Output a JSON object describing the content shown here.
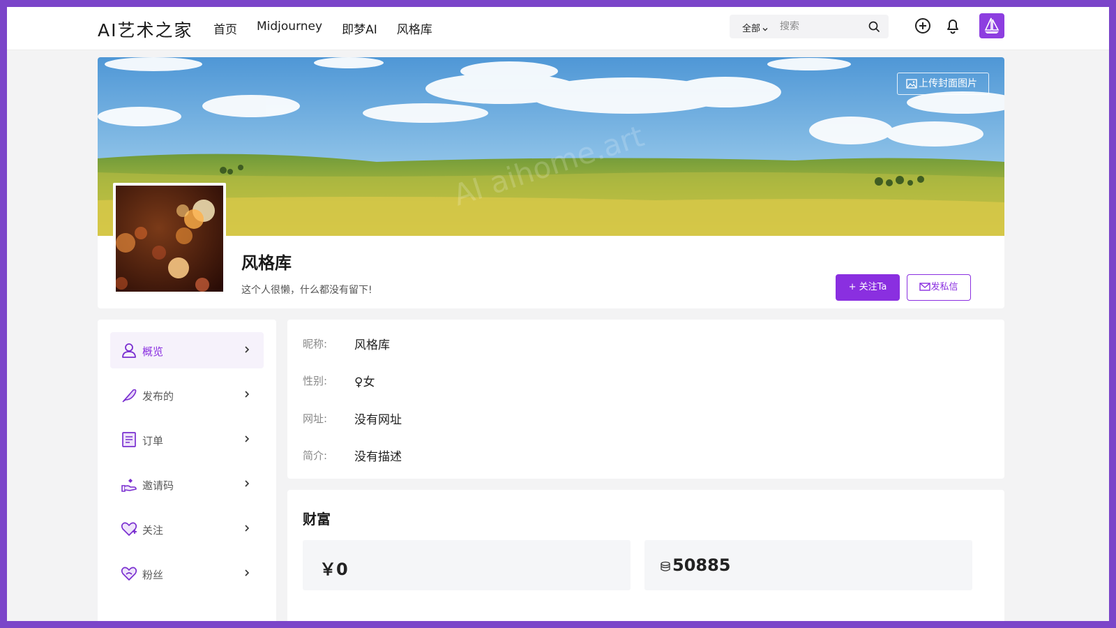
{
  "header": {
    "logo": "AI艺术之家",
    "nav": [
      "首页",
      "Midjourney",
      "即梦AI",
      "风格库"
    ],
    "search_scope": "全部",
    "search_placeholder": "搜索"
  },
  "banner": {
    "upload_label": "上传封面图片",
    "watermark": "AI aihome.art"
  },
  "profile": {
    "name": "风格库",
    "bio": "这个人很懒，什么都没有留下!",
    "follow_label": "+ 关注Ta",
    "message_label": "发私信"
  },
  "sidebar": {
    "items": [
      {
        "label": "概览",
        "icon": "user-icon",
        "active": true
      },
      {
        "label": "发布的",
        "icon": "feather-icon",
        "active": false
      },
      {
        "label": "订单",
        "icon": "order-icon",
        "active": false
      },
      {
        "label": "邀请码",
        "icon": "invite-icon",
        "active": false
      },
      {
        "label": "关注",
        "icon": "heart-plus-icon",
        "active": false
      },
      {
        "label": "粉丝",
        "icon": "heart-users-icon",
        "active": false
      }
    ]
  },
  "info": {
    "nickname_label": "昵称:",
    "nickname_value": "风格库",
    "gender_label": "性别:",
    "gender_value": "♀女",
    "website_label": "网址:",
    "website_value": "没有网址",
    "intro_label": "简介:",
    "intro_value": "没有描述"
  },
  "wealth": {
    "title": "财富",
    "money": "￥0",
    "coins": "50885"
  },
  "colors": {
    "accent": "#8a2fe0",
    "frame": "#7b45c9"
  }
}
